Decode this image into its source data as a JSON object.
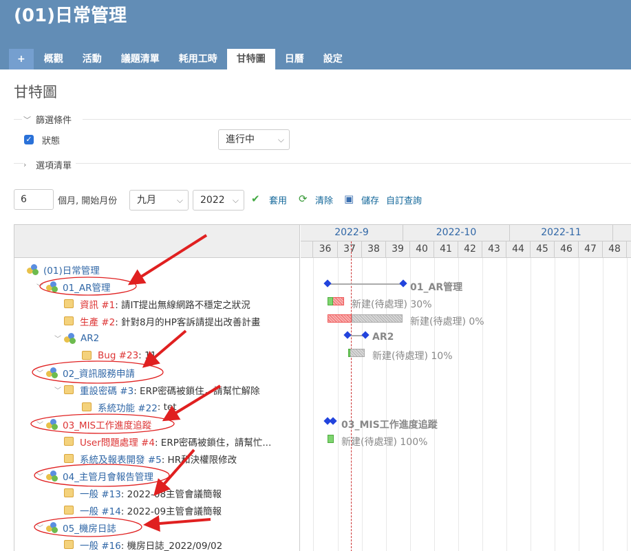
{
  "header": {
    "project_title": "(01)日常管理",
    "tabs": [
      "+",
      "概觀",
      "活動",
      "議題清單",
      "耗用工時",
      "甘特圖",
      "日曆",
      "設定"
    ]
  },
  "page": {
    "title": "甘特圖"
  },
  "filters": {
    "legend": "篩選條件",
    "status_label": "狀態",
    "status_checked": true,
    "status_value": "進行中",
    "options_legend": "選項清單"
  },
  "options": {
    "months_value": "6",
    "months_label": "個月, 開始月份",
    "month_select": "九月",
    "year_select": "2022",
    "apply": "套用",
    "clear": "清除",
    "save": "儲存",
    "custom_query": "自訂查詢"
  },
  "gantt": {
    "months": [
      "2022-9",
      "2022-10",
      "2022-11"
    ],
    "weeks": [
      "36",
      "37",
      "38",
      "39",
      "40",
      "41",
      "42",
      "43",
      "44",
      "45",
      "46",
      "47",
      "48"
    ],
    "subjects": [
      {
        "type": "project",
        "text": "(01)日常管理"
      },
      {
        "type": "project",
        "text": "01_AR管理"
      },
      {
        "type": "issue",
        "tracker": "資訊 #1",
        "subject": ": 請IT提出無線網路不穩定之狀況"
      },
      {
        "type": "issue",
        "tracker": "生產 #2",
        "subject": ": 針對8月的HP客訴請提出改善計畫"
      },
      {
        "type": "project",
        "text": "AR2"
      },
      {
        "type": "issue",
        "tracker": "Bug #23",
        "subject": ": 11"
      },
      {
        "type": "project",
        "text": "02_資訊服務申請"
      },
      {
        "type": "issue",
        "tracker": "重設密碼 #3",
        "subject": ": ERP密碼被鎖住，請幫忙解除"
      },
      {
        "type": "issue",
        "tracker": "系統功能 #22",
        "subject": ": tet"
      },
      {
        "type": "project",
        "text": "03_MIS工作進度追蹤"
      },
      {
        "type": "issue",
        "tracker": "User問題處理 #4",
        "subject": ": ERP密碼被鎖住，請幫忙..."
      },
      {
        "type": "issue",
        "tracker": "系統及報表開發 #5",
        "subject": ": HR和決權限修改"
      },
      {
        "type": "project",
        "text": "04_主管月會報告管理"
      },
      {
        "type": "issue",
        "tracker": "一般 #13",
        "subject": ": 2022-08主管會議簡報"
      },
      {
        "type": "issue",
        "tracker": "一般 #14",
        "subject": ": 2022-09主管會議簡報"
      },
      {
        "type": "project",
        "text": "05_機房日誌"
      },
      {
        "type": "issue",
        "tracker": "一般 #16",
        "subject": ": 機房日誌_2022/09/02"
      }
    ],
    "bars": [
      {
        "label": "01_AR管理"
      },
      {
        "label": "新建(待處理) 30%"
      },
      {
        "label": "新建(待處理) 0%"
      },
      {
        "label": "AR2"
      },
      {
        "label": "新建(待處理) 10%"
      },
      {
        "label": "03_MIS工作進度追蹤"
      },
      {
        "label": "新建(待處理) 100%"
      }
    ]
  },
  "colors": {
    "header_bg": "#628db6",
    "link": "#2f66a6",
    "overdue": "#dd3333",
    "annotation": "#e02020"
  }
}
